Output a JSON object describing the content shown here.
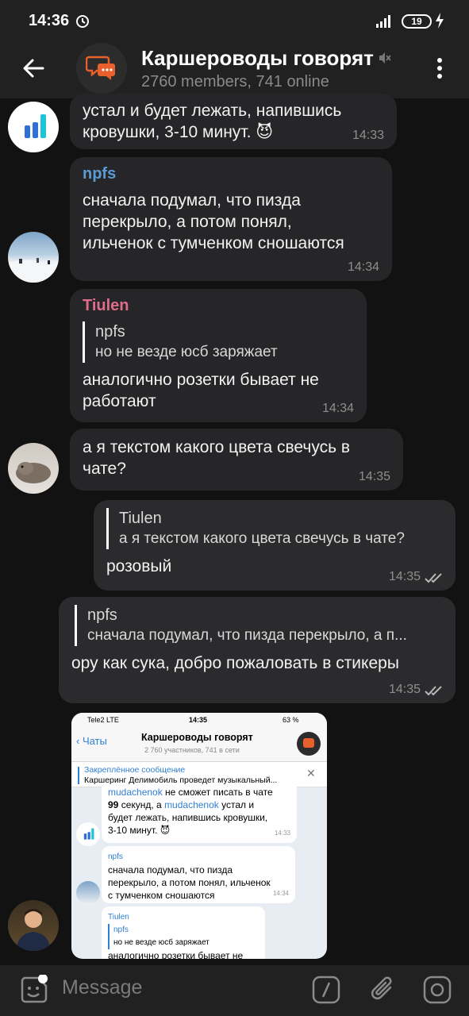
{
  "status_bar": {
    "time": "14:36",
    "battery": "19"
  },
  "header": {
    "title": "Каршероводы говорят",
    "subtitle": "2760 members, 741 online"
  },
  "messages": [
    {
      "id": "m1",
      "text": "устал и будет лежать, напившись\nкровушки, 3-10 минут. 😈",
      "time": "14:33"
    },
    {
      "id": "m2",
      "sender": "npfs",
      "sender_color": "#5a9bd4",
      "text": "сначала подумал, что пизда\nперекрыло, а потом понял,\nильченок с тумченком сношаются",
      "time": "14:34"
    },
    {
      "id": "m3",
      "sender": "Tiulen",
      "sender_color": "#e06c8c",
      "reply_name": "npfs",
      "reply_text": "но не везде юсб заряжает",
      "text": "аналогично розетки бывает не\nработают",
      "time": "14:34"
    },
    {
      "id": "m4",
      "text": "а я текстом какого цвета свечусь в\nчате?",
      "time": "14:35"
    },
    {
      "id": "m5",
      "out": true,
      "reply_name": "Tiulen",
      "reply_text": "а я текстом какого цвета свечусь в чате?",
      "text": "розовый",
      "time": "14:35"
    },
    {
      "id": "m6",
      "out": true,
      "reply_name": "npfs",
      "reply_text": "сначала подумал, что пизда перекрыло, а п...",
      "text": "ору как сука, добро пожаловать в стикеры",
      "time": "14:35"
    }
  ],
  "shared_screenshot": {
    "status_carrier": "Tele2  LTE",
    "status_time": "14:35",
    "status_battery": "63 %",
    "back_label": "Чаты",
    "title": "Каршероводы говорят",
    "subtitle": "2 760 участников, 741 в сети",
    "pinned_label": "Закреплённое сообщение",
    "pinned_text": "Каршеринг Делимобиль проведет музыкальный...",
    "msg1_line1_a": "mudachenok",
    "msg1_line1_b": " не сможет писать в чате",
    "msg1_line2_a": "99",
    "msg1_line2_b": " секунд, а ",
    "msg1_line2_c": "mudachenok",
    "msg1_line2_d": " устал и",
    "msg1_line3": "будет лежать, напившись кровушки,",
    "msg1_line4": "3-10 минут. 😈",
    "msg1_time": "14:33",
    "msg2_sender": "npfs",
    "msg2_text1": "сначала подумал, что пизда",
    "msg2_text2": "перекрыло, а потом понял, ильченок",
    "msg2_text3": "с тумченком сношаются",
    "msg2_time": "14:34",
    "msg3_sender": "Tiulen",
    "msg3_reply_name": "npfs",
    "msg3_reply_text": "но не везде юсб заряжает",
    "msg3_text": "аналогично розетки бывает не"
  },
  "input": {
    "placeholder": "Message"
  },
  "colors": {
    "accent_blue": "#5a9bd4",
    "accent_pink": "#e06c8c",
    "bg": "#121212",
    "bubble": "#262628"
  }
}
